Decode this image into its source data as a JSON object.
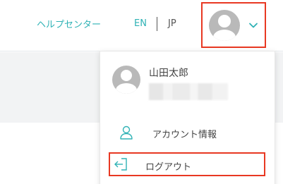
{
  "header": {
    "help_center": "ヘルプセンター",
    "lang_en": "EN",
    "lang_jp": "JP"
  },
  "user_menu": {
    "name": "山田太郎",
    "items": [
      {
        "label": "アカウント情報",
        "icon": "user-icon"
      },
      {
        "label": "ログアウト",
        "icon": "logout-icon"
      }
    ]
  },
  "colors": {
    "accent": "#2fb2b5",
    "highlight": "#e83822",
    "avatar": "#b9b9b9"
  }
}
